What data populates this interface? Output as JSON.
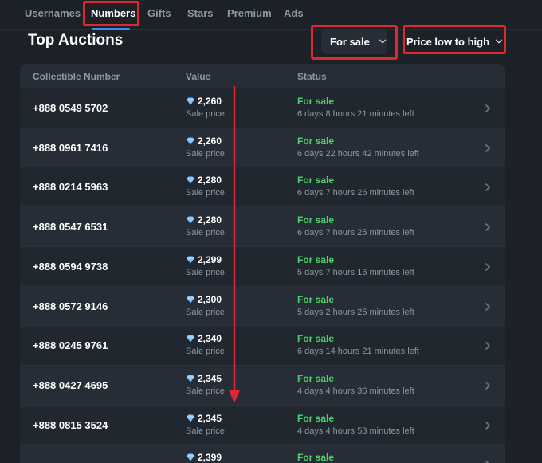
{
  "tabs": [
    {
      "label": "Usernames"
    },
    {
      "label": "Numbers"
    },
    {
      "label": "Gifts"
    },
    {
      "label": "Stars"
    },
    {
      "label": "Premium"
    },
    {
      "label": "Ads"
    }
  ],
  "page_title": "Top Auctions",
  "filters": {
    "status": "For sale",
    "sort": "Price low to high"
  },
  "columns": {
    "number": "Collectible Number",
    "value": "Value",
    "status": "Status"
  },
  "rows": [
    {
      "number": "+888 0549 5702",
      "value": "2,260",
      "value_sub": "Sale price",
      "status": "For sale",
      "time": "6 days 8 hours 21 minutes left"
    },
    {
      "number": "+888 0961 7416",
      "value": "2,260",
      "value_sub": "Sale price",
      "status": "For sale",
      "time": "6 days 22 hours 42 minutes left"
    },
    {
      "number": "+888 0214 5963",
      "value": "2,280",
      "value_sub": "Sale price",
      "status": "For sale",
      "time": "6 days 7 hours 26 minutes left"
    },
    {
      "number": "+888 0547 6531",
      "value": "2,280",
      "value_sub": "Sale price",
      "status": "For sale",
      "time": "6 days 7 hours 25 minutes left"
    },
    {
      "number": "+888 0594 9738",
      "value": "2,299",
      "value_sub": "Sale price",
      "status": "For sale",
      "time": "5 days 7 hours 16 minutes left"
    },
    {
      "number": "+888 0572 9146",
      "value": "2,300",
      "value_sub": "Sale price",
      "status": "For sale",
      "time": "5 days 2 hours 25 minutes left"
    },
    {
      "number": "+888 0245 9761",
      "value": "2,340",
      "value_sub": "Sale price",
      "status": "For sale",
      "time": "6 days 14 hours 21 minutes left"
    },
    {
      "number": "+888 0427 4695",
      "value": "2,345",
      "value_sub": "Sale price",
      "status": "For sale",
      "time": "4 days 4 hours 36 minutes left"
    },
    {
      "number": "+888 0815 3524",
      "value": "2,345",
      "value_sub": "Sale price",
      "status": "For sale",
      "time": "4 days 4 hours 53 minutes left"
    },
    {
      "number": "",
      "value": "2,399",
      "value_sub": "",
      "status": "For sale",
      "time": ""
    }
  ],
  "colors": {
    "background": "#1b2127",
    "accent": "#3f8cf3",
    "status_green": "#4ad36a",
    "annotation_red": "#e0262e",
    "ton_diamond": "#7fc6ff"
  },
  "icons": {
    "currency": "ton-diamond-icon",
    "row_action": "chevron-right-icon",
    "dropdown": "chevron-down-icon"
  }
}
